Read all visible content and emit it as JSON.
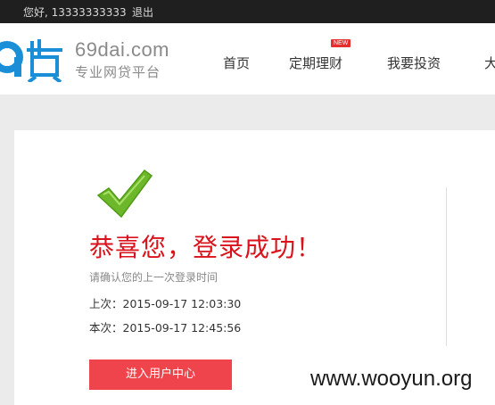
{
  "topbar": {
    "greeting": "您好, 13333333333",
    "logout": "退出"
  },
  "logo": {
    "domain": "69dai.com",
    "tagline": "专业网贷平台"
  },
  "nav": {
    "items": [
      "首页",
      "定期理财",
      "我要投资",
      "大"
    ],
    "badge": "NEW"
  },
  "success": {
    "title": "恭喜您，登录成功！",
    "confirm_text": "请确认您的上一次登录时间",
    "last_login": "上次：2015-09-17 12:03:30",
    "this_login": "本次：2015-09-17 12:45:56",
    "button": "进入用户中心"
  },
  "watermark": "www.wooyun.org",
  "colors": {
    "accent_red": "#d9121b",
    "button_red": "#f0444d",
    "logo_blue": "#1a8fd8",
    "check_green": "#6cb82a"
  }
}
